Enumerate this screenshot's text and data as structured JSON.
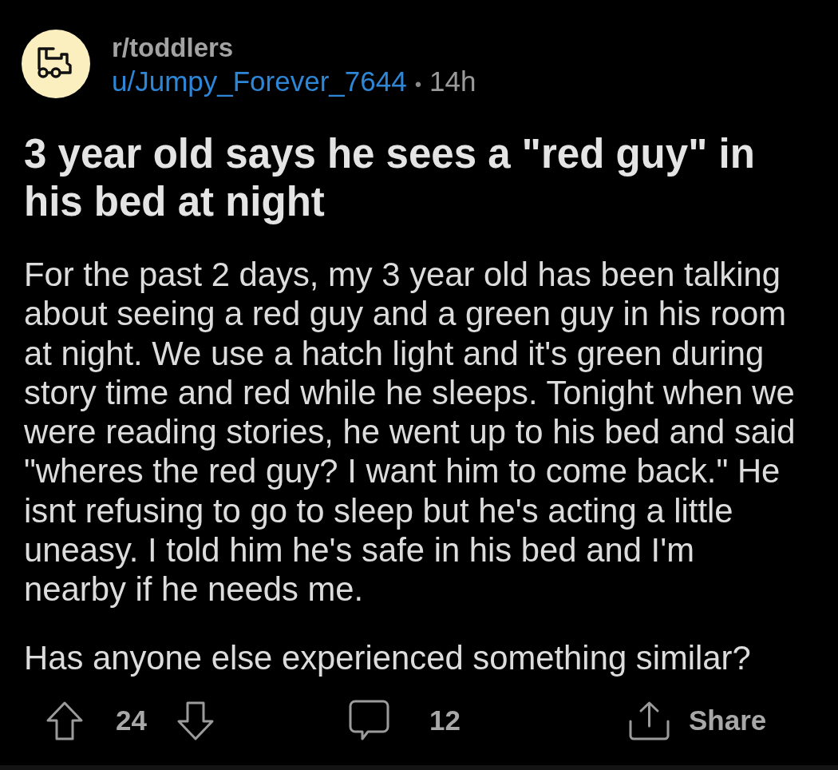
{
  "post": {
    "subreddit": "r/toddlers",
    "author": "u/Jumpy_Forever_7644",
    "separator": "•",
    "age": "14h",
    "title": "3 year old says he sees a \"red guy\" in his bed at night",
    "body": [
      "For the past 2 days, my 3 year old has been talking about seeing a red guy and a green guy in his room at night. We use a hatch light and it's green during story time and red while he sleeps. Tonight when we were reading stories, he went up to his bed and said \"wheres the red guy? I want him to come back.\" He isnt refusing to go to sleep but he's acting a little uneasy. I told him he's safe in his bed and I'm nearby if he needs me.",
      "Has anyone else experienced something similar?"
    ]
  },
  "actions": {
    "upvotes": "24",
    "comments": "12",
    "share": "Share"
  }
}
